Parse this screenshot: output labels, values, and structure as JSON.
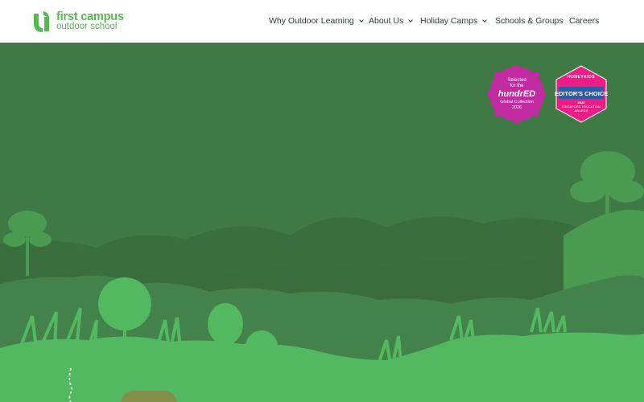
{
  "colors": {
    "brand_green": "#55b94f",
    "hero_dark": "#3f7a45",
    "hero_mid": "#43824a",
    "foliage_mid": "#3b6e3f",
    "foliage_light": "#52b960",
    "badge_magenta": "#c12aa0",
    "badge_pink": "#ea1e86",
    "badge_blue": "#2c5ca8",
    "nav_text": "#2f3b33"
  },
  "brand": {
    "name_line1": "first campus",
    "name_line2": "outdoor school",
    "logo_icon": "u-leaf-logo-icon"
  },
  "nav": {
    "items": [
      {
        "label": "Why Outdoor Learning",
        "has_dropdown": true
      },
      {
        "label": "About Us",
        "has_dropdown": true
      },
      {
        "label": "Holiday Camps",
        "has_dropdown": true
      },
      {
        "label": "Schools & Groups",
        "has_dropdown": false
      },
      {
        "label": "Careers",
        "has_dropdown": false
      }
    ]
  },
  "badges": {
    "hundred": {
      "line1": "Selected",
      "line2": "for the",
      "brand": "hundrED",
      "line3": "Global Collection",
      "line4": "2026"
    },
    "editor": {
      "top": "HONEYKIDS",
      "title": "EDITOR'S CHOICE",
      "year": "2025",
      "line1": "SINGAPORE EDUCATION",
      "line2": "AWARDS"
    }
  }
}
